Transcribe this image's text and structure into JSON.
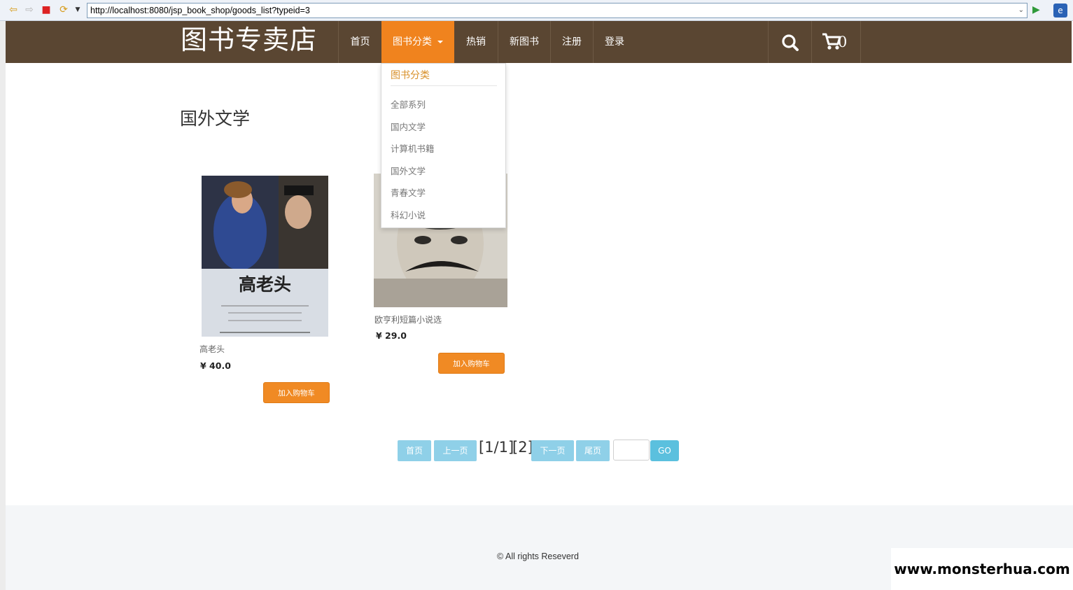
{
  "browser": {
    "url": "http://localhost:8080/jsp_book_shop/goods_list?typeid=3"
  },
  "navbar": {
    "brand": "图书专卖店",
    "items": [
      {
        "label": "首页"
      },
      {
        "label": "图书分类"
      },
      {
        "label": "热销"
      },
      {
        "label": "新图书"
      },
      {
        "label": "注册"
      },
      {
        "label": "登录"
      }
    ],
    "cart_count": "0"
  },
  "dropdown": {
    "title": "图书分类",
    "items": [
      "全部系列",
      "国内文学",
      "计算机书籍",
      "国外文学",
      "青春文学",
      "科幻小说"
    ]
  },
  "page": {
    "title": "国外文学"
  },
  "books": [
    {
      "name": "高老头",
      "price": "¥ 40.0",
      "button": "加入购物车",
      "cover_title": "高老头"
    },
    {
      "name": "欧亨利短篇小说选",
      "price": "¥ 29.0",
      "button": "加入购物车"
    }
  ],
  "pagination": {
    "first": "首页",
    "prev": "上一页",
    "page_info": "[1/1]",
    "page_link": "[2]",
    "next": "下一页",
    "last": "尾页",
    "go": "GO"
  },
  "footer": {
    "copyright": "© All rights Reseverd"
  },
  "watermark": "www.monsterhua.com",
  "colors": {
    "navbar_bg": "#5a4632",
    "accent": "#f0831e",
    "pagination": "#8fd0e8",
    "go_button": "#5bc0de"
  }
}
